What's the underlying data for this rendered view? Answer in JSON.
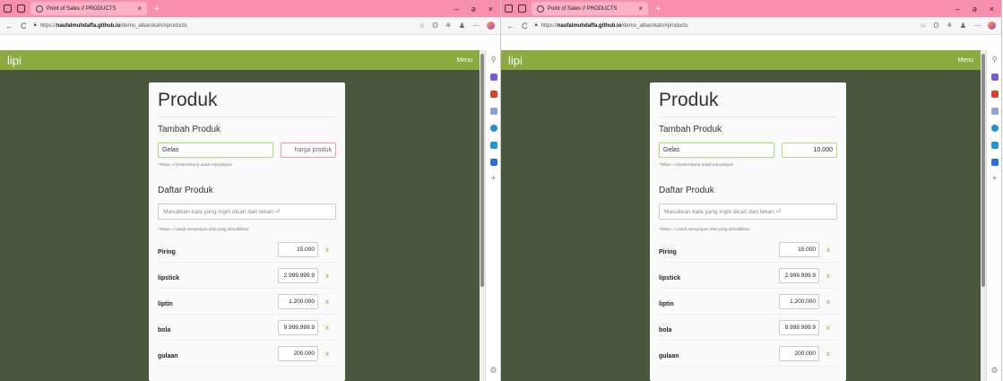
{
  "colors": {
    "tabbar": "#f98fae",
    "appbar": "#8bab41",
    "content": "#4a573f"
  },
  "windows": [
    {
      "tab_title": "Point of Sales // PRODUCTS",
      "url_domain": "naufalmuhdaffa.github.io",
      "url_path": "/demo_albarokah/#products",
      "url_prefix": "https://",
      "app": {
        "brand": "lipi",
        "menu": "Menu"
      },
      "card": {
        "title": "Produk",
        "add_title": "Tambah Produk",
        "name_value": "Gelas",
        "price_value": "",
        "price_placeholder": "harga produk",
        "add_hint": "*Tekan ⏎ (enter/return) untuk menyimpan",
        "list_title": "Daftar Produk",
        "search_placeholder": "Masukkan kata yang ingin dicari dan tekan ⏎",
        "list_hint": "*Tekan ⏎ untuk menyimpan data yang dimodifikasi",
        "items": [
          {
            "name": "Piring",
            "price": "15.000"
          },
          {
            "name": "lipstick",
            "price": "2.999.999.9"
          },
          {
            "name": "liptin",
            "price": "1.200.000"
          },
          {
            "name": "bola",
            "price": "9.999.999.9"
          },
          {
            "name": "gulaan",
            "price": "200.000"
          }
        ],
        "delete_label": "x"
      }
    },
    {
      "tab_title": "Point of Sales // PRODUCTS",
      "url_domain": "naufalmuhdaffa.github.io",
      "url_path": "/demo_albarokah/#products",
      "url_prefix": "https://",
      "app": {
        "brand": "lipi",
        "menu": "Menu"
      },
      "card": {
        "title": "Produk",
        "add_title": "Tambah Produk",
        "name_value": "Gelas",
        "price_value": "10.000",
        "price_placeholder": "harga produk",
        "add_hint": "*Tekan ⏎ (enter/return) untuk menyimpan",
        "list_title": "Daftar Produk",
        "search_placeholder": "Masukkan kata yang ingin dicari dan tekan ⏎",
        "list_hint": "*Tekan ⏎ untuk menyimpan data yang dimodifikasi",
        "items": [
          {
            "name": "Piring",
            "price": "15.000"
          },
          {
            "name": "lipstick",
            "price": "2.999.999.9"
          },
          {
            "name": "liptin",
            "price": "1.200.000"
          },
          {
            "name": "bola",
            "price": "9.999.999.9"
          },
          {
            "name": "gulaan",
            "price": "200.000"
          }
        ],
        "delete_label": "x"
      }
    }
  ]
}
